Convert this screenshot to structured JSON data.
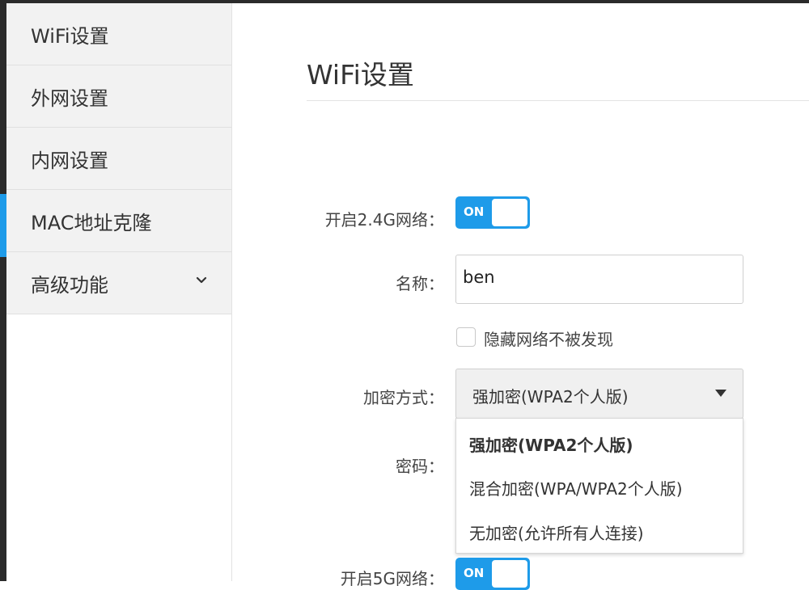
{
  "sidebar": {
    "items": [
      {
        "label": "WiFi设置"
      },
      {
        "label": "外网设置"
      },
      {
        "label": "内网设置"
      },
      {
        "label": "MAC地址克隆"
      },
      {
        "label": "高级功能",
        "icon": "chevron-down-icon"
      }
    ]
  },
  "main": {
    "title": "WiFi设置",
    "wifi24": {
      "label": "开启2.4G网络：",
      "state": "ON"
    },
    "name": {
      "label": "名称：",
      "value": "ben"
    },
    "hide": {
      "label": "隐藏网络不被发现",
      "checked": false
    },
    "encryption": {
      "label": "加密方式：",
      "selected": "强加密(WPA2个人版)",
      "options": [
        "强加密(WPA2个人版)",
        "混合加密(WPA/WPA2个人版)",
        "无加密(允许所有人连接)"
      ]
    },
    "password": {
      "label": "密码："
    },
    "wifi5": {
      "label": "开启5G网络：",
      "state": "ON"
    }
  },
  "colors": {
    "accent": "#1e9be9",
    "sidebar_bg": "#f2f2f2",
    "dark_frame": "#2b2b2b"
  }
}
